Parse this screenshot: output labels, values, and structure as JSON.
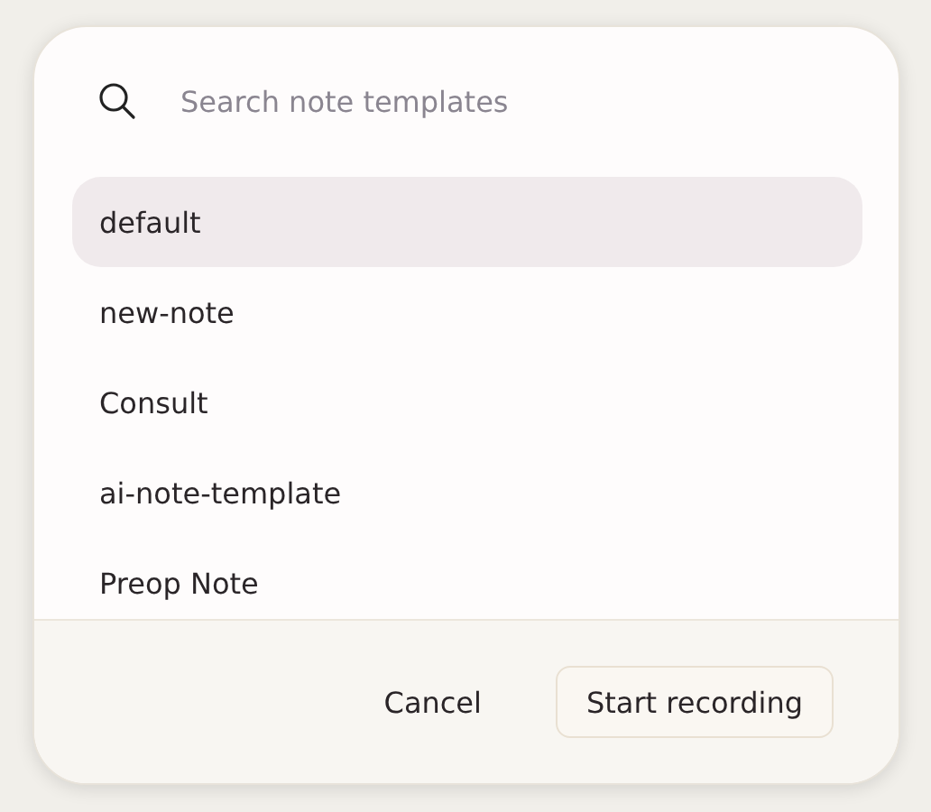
{
  "search": {
    "placeholder": "Search note templates"
  },
  "templates": [
    {
      "label": "default",
      "selected": true
    },
    {
      "label": "new-note",
      "selected": false
    },
    {
      "label": "Consult",
      "selected": false
    },
    {
      "label": "ai-note-template",
      "selected": false
    },
    {
      "label": "Preop Note",
      "selected": false
    }
  ],
  "buttons": [
    {
      "label": "Cancel",
      "kind": "plain"
    },
    {
      "label": "Start recording",
      "kind": "outlined"
    }
  ]
}
